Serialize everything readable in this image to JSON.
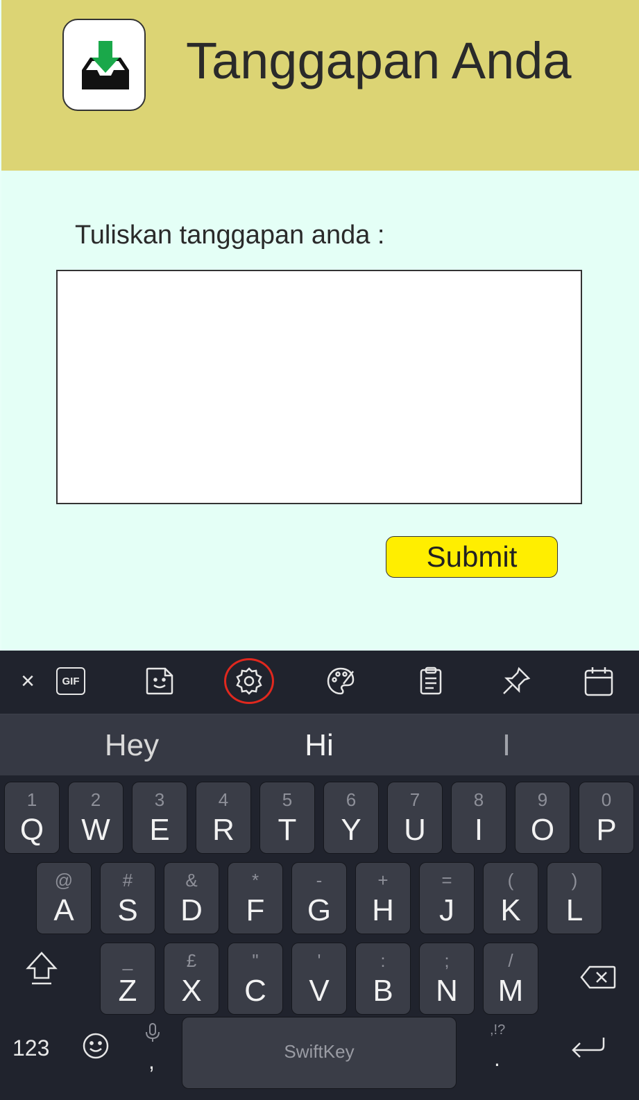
{
  "header": {
    "title": "Tanggapan Anda",
    "icon": "inbox-download-icon"
  },
  "form": {
    "label": "Tuliskan tanggapan anda :",
    "textarea_value": "",
    "submit_label": "Submit"
  },
  "keyboard": {
    "toolbar": [
      "close-icon",
      "gif-icon",
      "sticker-icon",
      "settings-icon",
      "theme-icon",
      "clipboard-icon",
      "pin-icon",
      "calendar-icon"
    ],
    "gif_label": "GIF",
    "close_label": "×",
    "suggestions": [
      "Hey",
      "Hi",
      "I"
    ],
    "row1": [
      [
        "1",
        "Q"
      ],
      [
        "2",
        "W"
      ],
      [
        "3",
        "E"
      ],
      [
        "4",
        "R"
      ],
      [
        "5",
        "T"
      ],
      [
        "6",
        "Y"
      ],
      [
        "7",
        "U"
      ],
      [
        "8",
        "I"
      ],
      [
        "9",
        "O"
      ],
      [
        "0",
        "P"
      ]
    ],
    "row2": [
      [
        "@",
        "A"
      ],
      [
        "#",
        "S"
      ],
      [
        "&",
        "D"
      ],
      [
        "*",
        "F"
      ],
      [
        "-",
        "G"
      ],
      [
        "+",
        "H"
      ],
      [
        "=",
        "J"
      ],
      [
        "(",
        "K"
      ],
      [
        ")",
        "L"
      ]
    ],
    "row3": [
      [
        "_",
        "Z"
      ],
      [
        "£",
        "X"
      ],
      [
        "\"",
        "C"
      ],
      [
        "'",
        "V"
      ],
      [
        ":",
        "B"
      ],
      [
        ";",
        "N"
      ],
      [
        "/",
        "M"
      ]
    ],
    "num_label": "123",
    "comma": ",",
    "period": ".",
    "punct_hint": ",!?",
    "space_label": "SwiftKey"
  }
}
